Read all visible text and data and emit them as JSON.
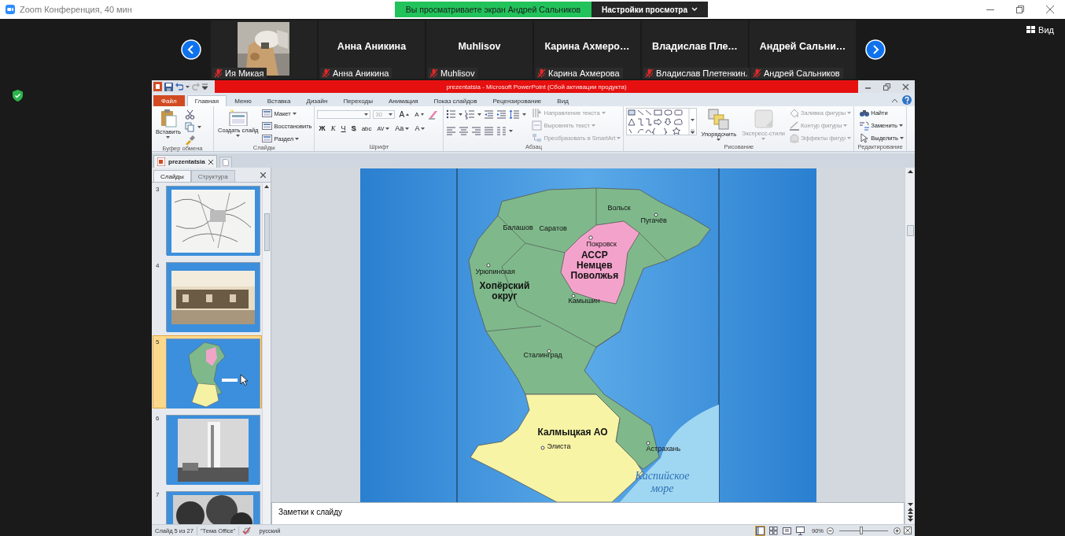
{
  "zoom": {
    "title": "Zoom Конференция, 40 мин",
    "share_banner": "Вы просматриваете экран Андрей Сальников",
    "view_options": "Настройки просмотра",
    "view_button": "Вид"
  },
  "participants": [
    {
      "kind": "video",
      "label": "Ия Микая",
      "muted": true
    },
    {
      "kind": "name",
      "heading": "Анна Аникина",
      "label": "Анна Аникина",
      "muted": true
    },
    {
      "kind": "name",
      "heading": "Muhlisov",
      "label": "Muhlisov",
      "muted": true
    },
    {
      "kind": "name",
      "heading": "Карина Ахмеро…",
      "label": "Карина Ахмерова",
      "muted": true
    },
    {
      "kind": "name",
      "heading": "Владислав Пле…",
      "label": "Владислав Плетенкин.",
      "muted": true
    },
    {
      "kind": "name",
      "heading": "Андрей Сальни…",
      "label": "Андрей Сальников",
      "muted": true
    }
  ],
  "powerpoint": {
    "title": "prezentatsia - Microsoft PowerPoint (Сбой активации продукта)",
    "ribbon_tabs": [
      {
        "label": "Файл",
        "kind": "file",
        "selected": false
      },
      {
        "label": "Главная",
        "kind": "tab",
        "selected": true
      },
      {
        "label": "Меню",
        "kind": "tab",
        "selected": false
      },
      {
        "label": "Вставка",
        "kind": "tab",
        "selected": false
      },
      {
        "label": "Дизайн",
        "kind": "tab",
        "selected": false
      },
      {
        "label": "Переходы",
        "kind": "tab",
        "selected": false
      },
      {
        "label": "Анимация",
        "kind": "tab",
        "selected": false
      },
      {
        "label": "Показ слайдов",
        "kind": "tab",
        "selected": false
      },
      {
        "label": "Рецензирование",
        "kind": "tab",
        "selected": false
      },
      {
        "label": "Вид",
        "kind": "tab",
        "selected": false
      }
    ],
    "ribbon": {
      "clipboard": {
        "label": "Буфер обмена",
        "paste": "Вставить"
      },
      "slides": {
        "label": "Слайды",
        "new_slide": "Создать слайд",
        "layout": "Макет",
        "reset": "Восстановить",
        "section": "Раздел"
      },
      "font": {
        "label": "Шрифт",
        "size": {
          "value": "30",
          "disabled": true
        },
        "grow": "A",
        "shrink": "A",
        "format_buttons": [
          {
            "label": "Ж",
            "kind": "bold"
          },
          {
            "label": "К",
            "kind": "italic"
          },
          {
            "label": "Ч",
            "kind": "underline"
          },
          {
            "label": "S",
            "kind": "shadow"
          },
          {
            "label": "abc",
            "kind": "strike"
          },
          {
            "label": "AV",
            "kind": "spacing"
          },
          {
            "label": "Aa",
            "kind": "case"
          },
          {
            "label": "A",
            "kind": "color"
          }
        ]
      },
      "paragraph": {
        "label": "Абзац",
        "commands": [
          {
            "label": "Направление текста",
            "disabled": true
          },
          {
            "label": "Выровнять текст",
            "disabled": true
          },
          {
            "label": "Преобразовать в SmartArt",
            "disabled": true
          }
        ]
      },
      "drawing": {
        "label": "Рисование",
        "arrange": "Упорядочить",
        "quick_styles": {
          "label": "Экспресс-стили",
          "disabled": true
        },
        "commands": [
          {
            "label": "Заливка фигуры",
            "disabled": true
          },
          {
            "label": "Контур фигуры",
            "disabled": true
          },
          {
            "label": "Эффекты фигур",
            "disabled": true
          }
        ]
      },
      "editing": {
        "label": "Редактирование",
        "commands": [
          {
            "label": "Найти",
            "dropdown": false
          },
          {
            "label": "Заменить",
            "dropdown": true
          },
          {
            "label": "Выделить",
            "dropdown": true
          }
        ]
      }
    },
    "document_tab": "prezentatsia",
    "pane_tabs": [
      {
        "label": "Слайды",
        "selected": true
      },
      {
        "label": "Структура",
        "selected": false
      }
    ],
    "slides": [
      {
        "number": "3",
        "selected": false
      },
      {
        "number": "4",
        "selected": false
      },
      {
        "number": "5",
        "selected": true
      },
      {
        "number": "6",
        "selected": false
      },
      {
        "number": "7",
        "selected": false
      }
    ],
    "map_labels": [
      {
        "text": "Вольск",
        "kind": "city"
      },
      {
        "text": "Пугачёв",
        "kind": "city"
      },
      {
        "text": "Балашов",
        "kind": "city"
      },
      {
        "text": "Саратов",
        "kind": "city"
      },
      {
        "text": "Покровск",
        "kind": "city"
      },
      {
        "text": "Урюпинская",
        "kind": "city"
      },
      {
        "text": "АССР Немцев Поволжья",
        "kind": "region"
      },
      {
        "text": "Хопёрский округ",
        "kind": "region"
      },
      {
        "text": "Камышин",
        "kind": "city"
      },
      {
        "text": "Сталинград",
        "kind": "city"
      },
      {
        "text": "Калмыцкая АО",
        "kind": "region"
      },
      {
        "text": "Элиста",
        "kind": "city"
      },
      {
        "text": "Астрахань",
        "kind": "city"
      },
      {
        "text": "Каспийское море",
        "kind": "sea"
      }
    ],
    "notes": "Заметки к слайду",
    "status": {
      "slide": "Слайд 5 из 27",
      "theme": "\"Тема Office\"",
      "language": "русский",
      "views": [
        {
          "selected": true
        },
        {
          "selected": false
        },
        {
          "selected": false
        },
        {
          "selected": false
        }
      ],
      "zoom": "90%",
      "zoom_slider": {
        "level": 0.45
      }
    }
  }
}
